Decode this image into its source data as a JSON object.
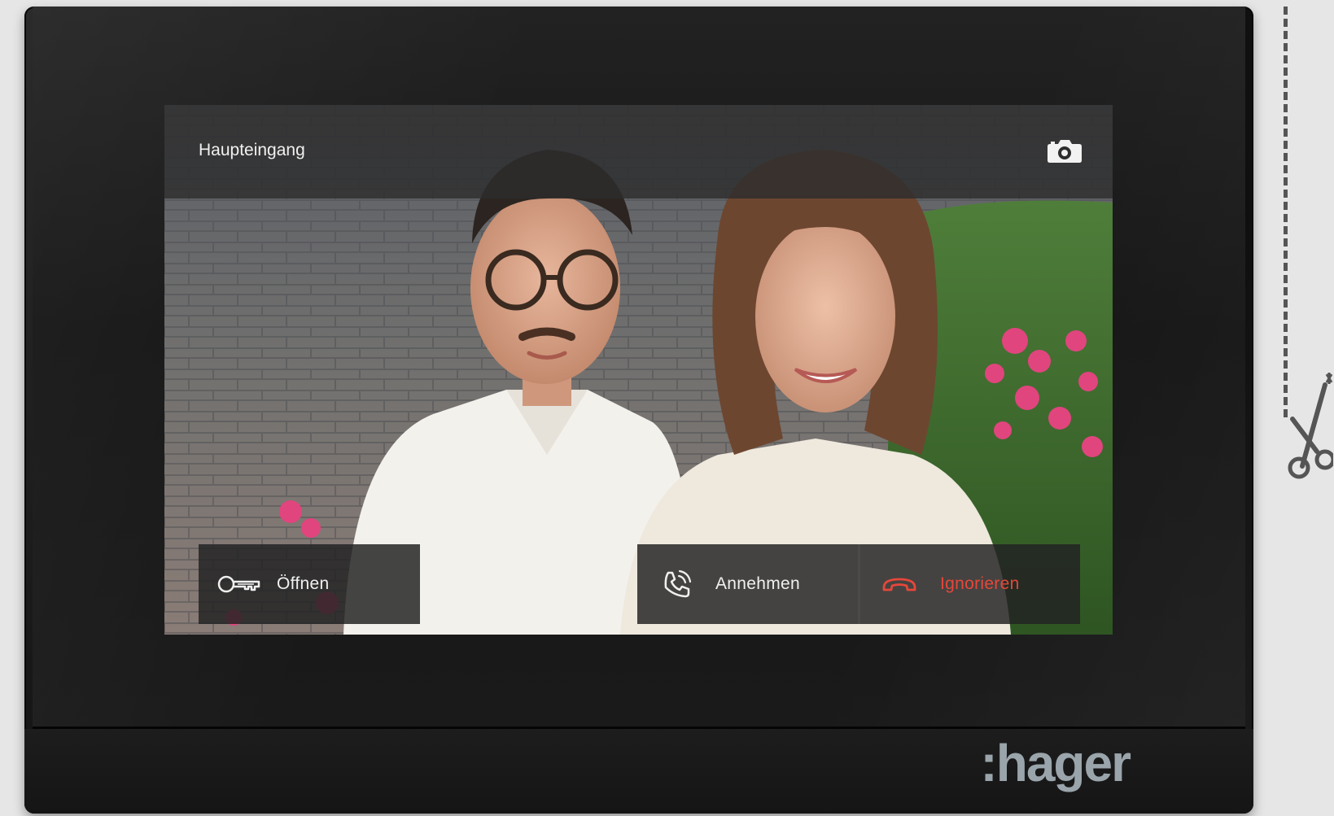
{
  "screen": {
    "title": "Haupteingang",
    "camera_icon": "camera-icon"
  },
  "actions": {
    "open": {
      "label": "Öffnen",
      "icon": "key-icon"
    },
    "accept": {
      "label": "Annehmen",
      "icon": "phone-ringing-icon"
    },
    "ignore": {
      "label": "Ignorieren",
      "icon": "hang-up-icon",
      "color": "#e6473a"
    }
  },
  "brand": {
    "logo_text": ":hager"
  },
  "cut_mark_icon": "scissors-icon"
}
